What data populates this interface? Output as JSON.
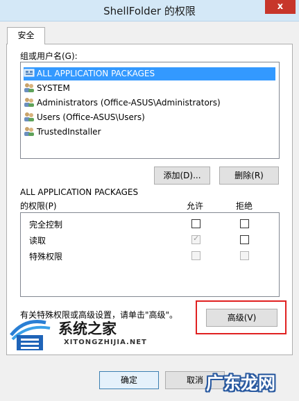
{
  "window": {
    "title": "ShellFolder 的权限",
    "close_symbol": "x"
  },
  "tabs": [
    {
      "label": "安全"
    }
  ],
  "users": {
    "heading": "组或用户名(G):",
    "items": [
      {
        "label": "ALL APPLICATION PACKAGES",
        "icon": "packages-icon",
        "selected": true
      },
      {
        "label": "SYSTEM",
        "icon": "users-icon"
      },
      {
        "label": "Administrators (Office-ASUS\\Administrators)",
        "icon": "users-icon"
      },
      {
        "label": "Users (Office-ASUS\\Users)",
        "icon": "users-icon"
      },
      {
        "label": "TrustedInstaller",
        "icon": "users-icon"
      }
    ],
    "add_label": "添加(D)...",
    "remove_label": "删除(R)"
  },
  "permissions": {
    "heading_line1": "ALL APPLICATION PACKAGES",
    "heading_line2": "的权限(P)",
    "allow_header": "允许",
    "deny_header": "拒绝",
    "rows": [
      {
        "name": "完全控制",
        "allow": false,
        "deny": false,
        "disabled": false
      },
      {
        "name": "读取",
        "allow": true,
        "deny": false,
        "disabled": false,
        "allow_disabled": true
      },
      {
        "name": "特殊权限",
        "allow": false,
        "deny": false,
        "disabled": true
      }
    ]
  },
  "advanced": {
    "hint": "有关特殊权限或高级设置，请单击\"高级\"。",
    "button_label": "高级(V)"
  },
  "footer": {
    "ok_label": "确定",
    "cancel_label": "取消"
  },
  "watermarks": {
    "site1_name": "系统之家",
    "site1_url": "XITONGZHIJIA.NET",
    "site2_name": "广东龙网"
  },
  "colors": {
    "selection": "#3399ff",
    "highlight_box": "#e02020",
    "close_button": "#c7362b"
  }
}
